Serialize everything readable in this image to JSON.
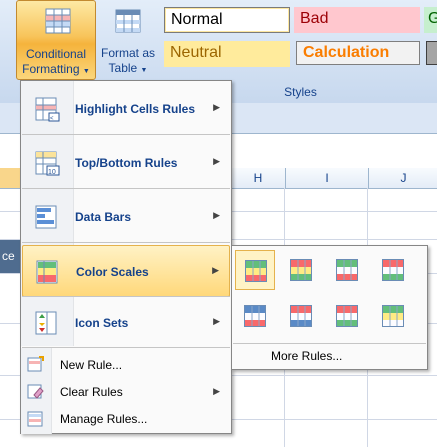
{
  "ribbon": {
    "conditional_formatting": {
      "line1": "Conditional",
      "line2": "Formatting"
    },
    "format_as_table": {
      "line1": "Format as",
      "line2": "Table"
    },
    "styles": {
      "normal": "Normal",
      "bad": "Bad",
      "good_stub": "G",
      "neutral": "Neutral",
      "calculation": "Calculation",
      "group_label": "Styles"
    }
  },
  "grid": {
    "columns": [
      "H",
      "I",
      "J"
    ],
    "left_cell_text": "ce"
  },
  "menu": {
    "items": [
      {
        "label": "Highlight Cells Rules",
        "icon": "highlight-cells-icon",
        "arrow": "▶"
      },
      {
        "label": "Top/Bottom Rules",
        "icon": "top-bottom-icon",
        "arrow": "▶"
      },
      {
        "label": "Data Bars",
        "icon": "data-bars-icon",
        "arrow": "▶"
      },
      {
        "label": "Color Scales",
        "icon": "color-scales-icon",
        "arrow": "▶"
      },
      {
        "label": "Icon Sets",
        "icon": "icon-sets-icon",
        "arrow": "▶"
      }
    ],
    "small_items": [
      {
        "label": "New Rule...",
        "icon": "new-rule-icon"
      },
      {
        "label": "Clear Rules",
        "icon": "clear-rules-icon",
        "arrow": "▶"
      },
      {
        "label": "Manage Rules...",
        "icon": "manage-rules-icon"
      }
    ]
  },
  "color_scales": {
    "swatches": [
      {
        "colors": [
          "#63be7b",
          "#ffeb84",
          "#f8696b"
        ]
      },
      {
        "colors": [
          "#f8696b",
          "#ffeb84",
          "#63be7b"
        ]
      },
      {
        "colors": [
          "#63be7b",
          "#fcfcff",
          "#f8696b"
        ]
      },
      {
        "colors": [
          "#f8696b",
          "#fcfcff",
          "#63be7b"
        ]
      },
      {
        "colors": [
          "#5a8ac6",
          "#fcfcff",
          "#f8696b"
        ]
      },
      {
        "colors": [
          "#f8696b",
          "#fcfcff",
          "#5a8ac6"
        ]
      },
      {
        "colors": [
          "#f8696b",
          "#fcfcff",
          "#63be7b"
        ]
      },
      {
        "colors": [
          "#63be7b",
          "#ffeb84",
          "#fcfcff"
        ]
      }
    ],
    "more_rules": "More Rules..."
  }
}
